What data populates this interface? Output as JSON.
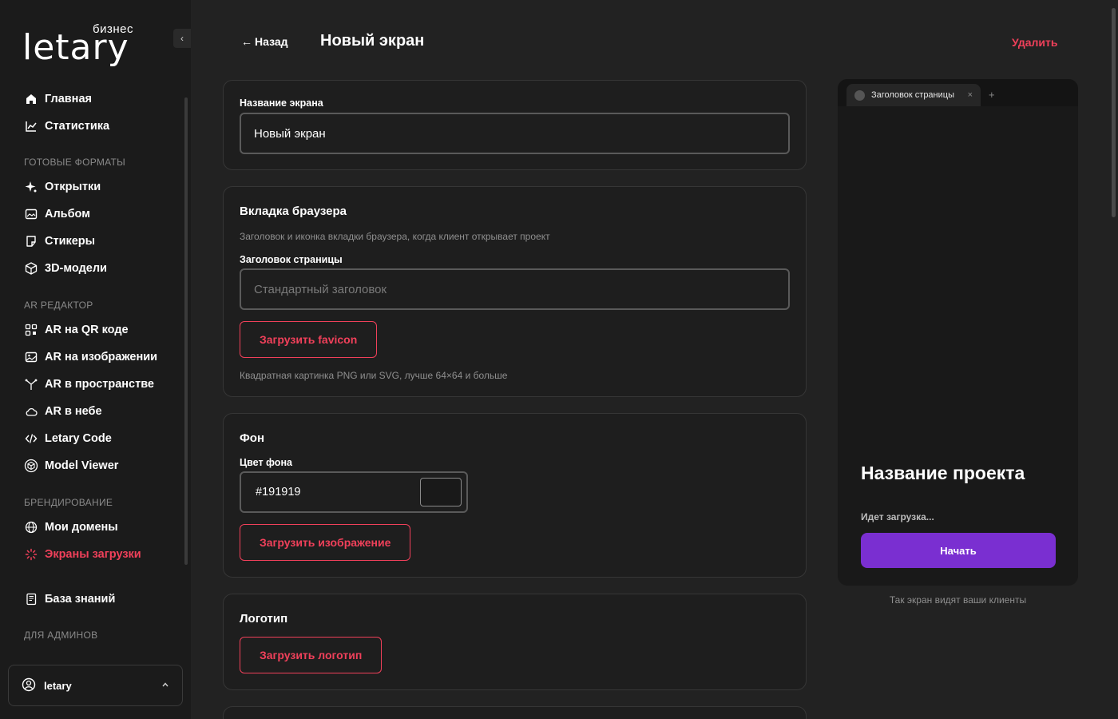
{
  "brand": {
    "sub": "бизнес",
    "name": "letary"
  },
  "sidebar": {
    "items_top": [
      {
        "label": "Главная",
        "icon": "home-icon"
      },
      {
        "label": "Статистика",
        "icon": "chart-icon"
      }
    ],
    "sections": [
      {
        "title": "ГОТОВЫЕ ФОРМАТЫ",
        "items": [
          {
            "label": "Открытки",
            "icon": "sparkle-icon"
          },
          {
            "label": "Альбом",
            "icon": "album-icon"
          },
          {
            "label": "Стикеры",
            "icon": "sticker-icon"
          },
          {
            "label": "3D-модели",
            "icon": "cube-icon"
          }
        ]
      },
      {
        "title": "AR РЕДАКТОР",
        "items": [
          {
            "label": "AR на QR коде",
            "icon": "qr-icon"
          },
          {
            "label": "AR на изображении",
            "icon": "image-icon"
          },
          {
            "label": "AR в пространстве",
            "icon": "space-icon"
          },
          {
            "label": "AR в небе",
            "icon": "cloud-icon"
          },
          {
            "label": "Letary Code",
            "icon": "code-icon"
          },
          {
            "label": "Model Viewer",
            "icon": "model-viewer-icon"
          }
        ]
      },
      {
        "title": "БРЕНДИРОВАНИЕ",
        "items": [
          {
            "label": "Мои домены",
            "icon": "globe-icon"
          },
          {
            "label": "Экраны загрузки",
            "icon": "loader-icon",
            "active": true
          }
        ]
      }
    ],
    "knowledge": {
      "label": "База знаний",
      "icon": "book-icon"
    },
    "admins_title": "ДЛЯ АДМИНОВ",
    "user": {
      "name": "letary"
    }
  },
  "header": {
    "back": "Назад",
    "title": "Новый экран",
    "delete": "Удалить"
  },
  "form": {
    "name_card": {
      "label": "Название экрана",
      "value": "Новый экран"
    },
    "tab_card": {
      "title": "Вкладка браузера",
      "desc": "Заголовок и иконка вкладки браузера, когда клиент открывает проект",
      "field_label": "Заголовок страницы",
      "placeholder": "Стандартный заголовок",
      "upload": "Загрузить favicon",
      "hint": "Квадратная картинка PNG или SVG, лучше 64×64 и больше"
    },
    "bg_card": {
      "title": "Фон",
      "field_label": "Цвет фона",
      "color": "#191919",
      "upload": "Загрузить изображение"
    },
    "logo_card": {
      "title": "Логотип",
      "upload": "Загрузить логотип"
    }
  },
  "preview": {
    "tab_title": "Заголовок страницы",
    "project": "Название проекта",
    "loading": "Идет загрузка...",
    "start": "Начать",
    "caption": "Так экран видят ваши клиенты"
  },
  "colors": {
    "accent": "#f0405a",
    "button": "#7a2fd1",
    "background": "#222222",
    "sidebar": "#1b1b1b"
  }
}
